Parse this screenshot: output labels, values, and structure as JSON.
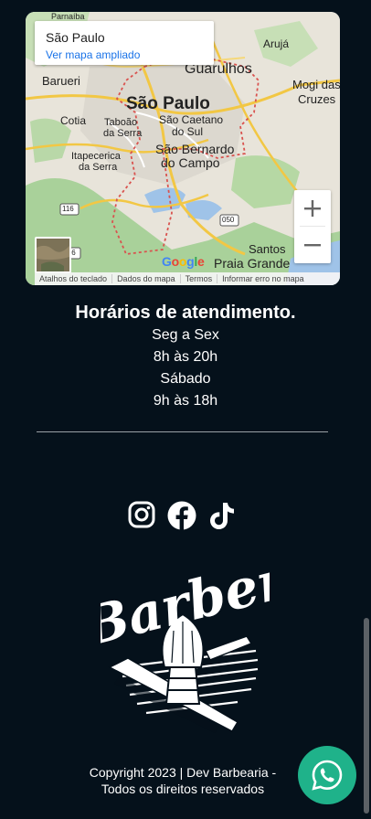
{
  "map": {
    "place_name": "São Paulo",
    "view_larger_label": "Ver mapa ampliado",
    "labels": [
      "Arujá",
      "Guarulhos",
      "Mogi das",
      "Cruzes",
      "Barueri",
      "São Paulo",
      "Cotia",
      "Taboão",
      "da Serra",
      "São Caetano",
      "do Sul",
      "Itapecerica",
      "da Serra",
      "São Bernardo",
      "do Campo",
      "Santos",
      "Praia Grande",
      "Parnaíba"
    ],
    "road_shields": [
      "116",
      "116",
      "050"
    ],
    "zoom_in_label": "+",
    "zoom_out_label": "−",
    "google_logo": "Google",
    "attribution": [
      "Atalhos do teclado",
      "Dados do mapa",
      "Termos",
      "Informar erro no mapa"
    ]
  },
  "hours": {
    "title": "Horários de atendimento.",
    "lines": [
      "Seg a Sex",
      "8h às 20h",
      "Sábado",
      "9h às 18h"
    ]
  },
  "social": [
    "instagram-icon",
    "facebook-icon",
    "tiktok-icon"
  ],
  "logo": {
    "text": "Barber"
  },
  "footer": {
    "copyright_line1": "Copyright 2023 | Dev Barbearia -",
    "copyright_line2": "Todos os direitos reservados"
  },
  "colors": {
    "background": "#05111b",
    "whatsapp": "#1fb28a",
    "map_link": "#1a73e8"
  }
}
